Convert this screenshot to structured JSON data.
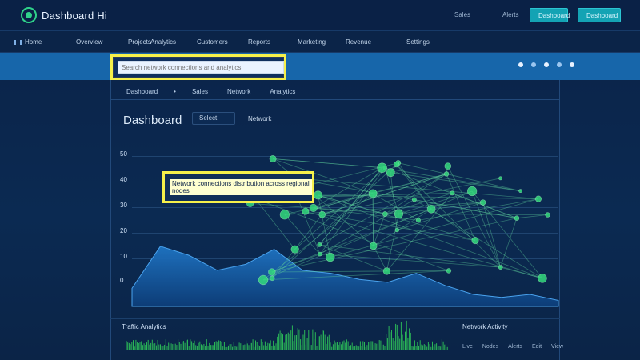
{
  "app": {
    "title": "Dashboard Hi",
    "logo_icon": "circle-logo-icon"
  },
  "topbar": {
    "links": [
      "Sales",
      "Alerts"
    ],
    "buttons": [
      "Dashboard",
      "Dashboard"
    ]
  },
  "nav": {
    "items": [
      {
        "label": "Home",
        "icon": "menu-icon"
      },
      {
        "label": "Overview"
      },
      {
        "label": "Projects"
      },
      {
        "label": "Analytics"
      },
      {
        "label": "Customers"
      },
      {
        "label": "Reports"
      },
      {
        "label": "Marketing"
      },
      {
        "label": "Revenue"
      },
      {
        "label": "Settings"
      }
    ]
  },
  "subbar": {
    "search_placeholder": "Search network connections and analytics",
    "icons": [
      "settings-icon",
      "user-icon",
      "notification-icon",
      "help-icon",
      "menu-icon"
    ]
  },
  "tabs": {
    "items": [
      "Dashboard",
      "Sales",
      "Network",
      "Analytics"
    ]
  },
  "section": {
    "title": "Dashboard",
    "filter1": "Select",
    "filter2": "Network"
  },
  "chart": {
    "y_ticks": [
      "50",
      "40",
      "30",
      "20",
      "10",
      "0"
    ],
    "tooltip_text": "Network connections distribution across regional nodes"
  },
  "bottom": {
    "left_title": "Traffic Analytics",
    "right_title": "Network Activity",
    "right_items": [
      "Live",
      "Nodes",
      "Alerts",
      "Edit",
      "View"
    ]
  },
  "chart_data": {
    "type": "area",
    "x": [
      0,
      1,
      2,
      3,
      4,
      5,
      6,
      7,
      8,
      9,
      10,
      11,
      12,
      13,
      14,
      15
    ],
    "series": [
      {
        "values": [
          6,
          20,
          17,
          12,
          14,
          19,
          12,
          11,
          9,
          8,
          11,
          7,
          4,
          3,
          4,
          2
        ]
      }
    ],
    "ylim": [
      0,
      50
    ],
    "grid": true,
    "network_nodes": 44,
    "network_edges": 95
  },
  "colors": {
    "accent": "#2fd28a",
    "node": "#34d97c",
    "line": "#5ecf9b",
    "area_top": "#1f75c4",
    "area_bottom": "#0d3f7c",
    "highlight": "#f6f04a"
  }
}
